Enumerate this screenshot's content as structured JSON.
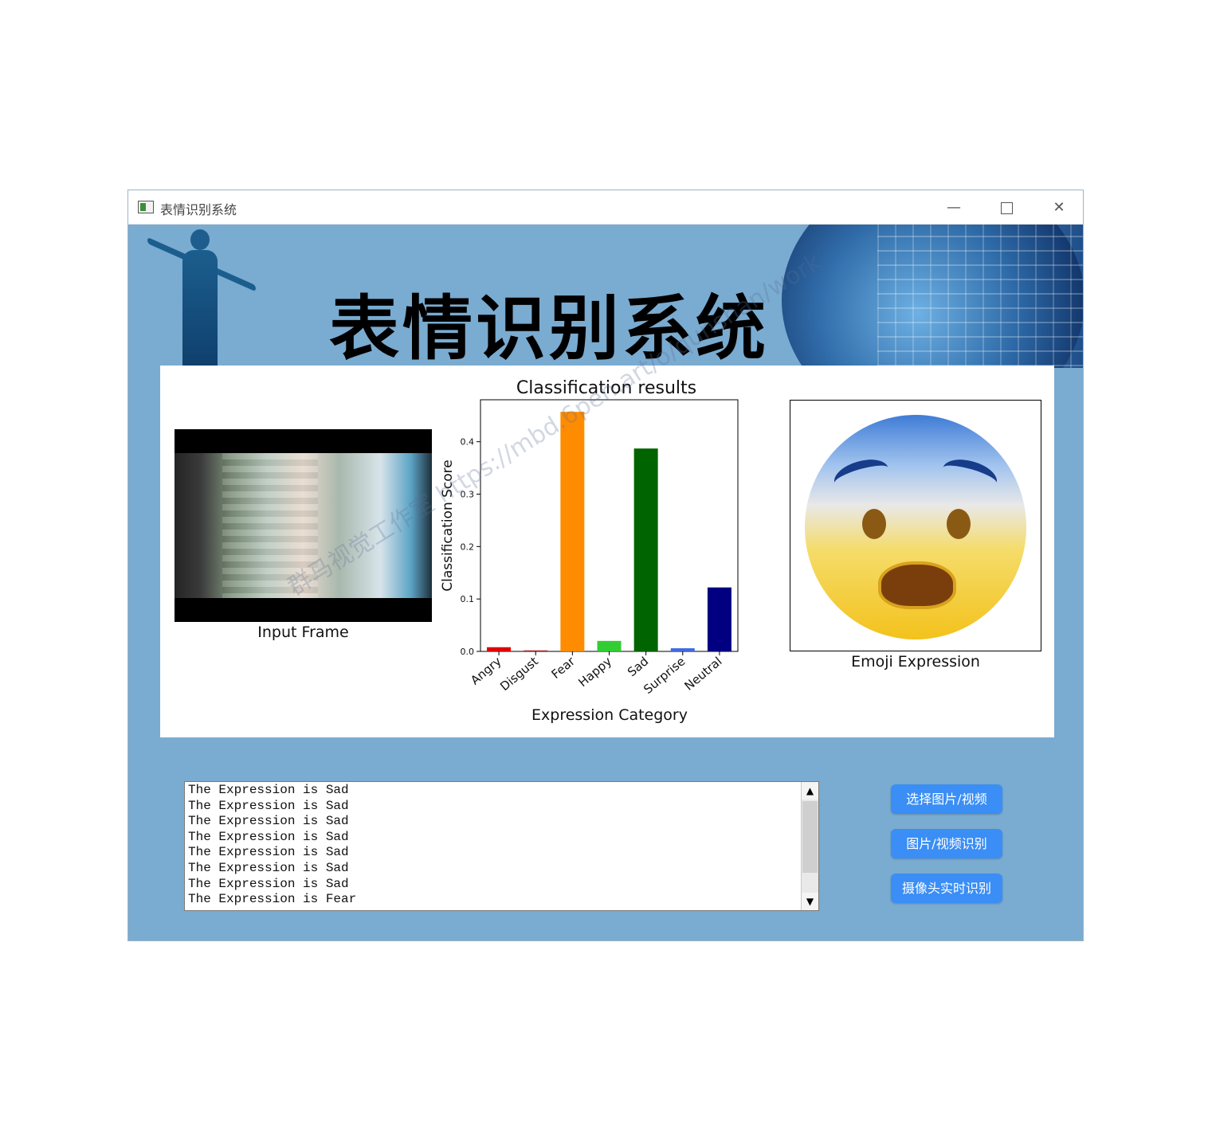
{
  "window": {
    "title": "表情识别系统",
    "controls": {
      "minimize": "—",
      "maximize": "",
      "close": "✕"
    }
  },
  "banner": {
    "title": "表情识别系统"
  },
  "input_frame": {
    "caption": "Input Frame"
  },
  "chart_data": {
    "type": "bar",
    "title": "Classification results",
    "xlabel": "Expression Category",
    "ylabel": "Classification Score",
    "categories": [
      "Angry",
      "Disgust",
      "Fear",
      "Happy",
      "Sad",
      "Surprise",
      "Neutral"
    ],
    "values": [
      0.008,
      0.002,
      0.457,
      0.02,
      0.387,
      0.006,
      0.122
    ],
    "colors": [
      "#e00000",
      "#a52a2a",
      "#ff8c00",
      "#32cd32",
      "#006400",
      "#4169e1",
      "#000080"
    ],
    "yticks": [
      "0.0",
      "0.1",
      "0.2",
      "0.3",
      "0.4"
    ],
    "ylim": [
      0,
      0.48
    ],
    "grid": false
  },
  "emoji": {
    "caption": "Emoji Expression",
    "expression": "fearful-face"
  },
  "watermark": {
    "text": "群马视觉工作室 https://mbd.6pen.art/o/qunshan/work"
  },
  "log": {
    "lines": [
      "The Expression is Sad",
      "The Expression is Sad",
      "The Expression is Sad",
      "The Expression is Sad",
      "The Expression is Sad",
      "The Expression is Sad",
      "The Expression is Sad",
      "The Expression is Fear"
    ]
  },
  "buttons": {
    "select": "选择图片/视频",
    "recognize": "图片/视频识别",
    "camera": "摄像头实时识别"
  }
}
